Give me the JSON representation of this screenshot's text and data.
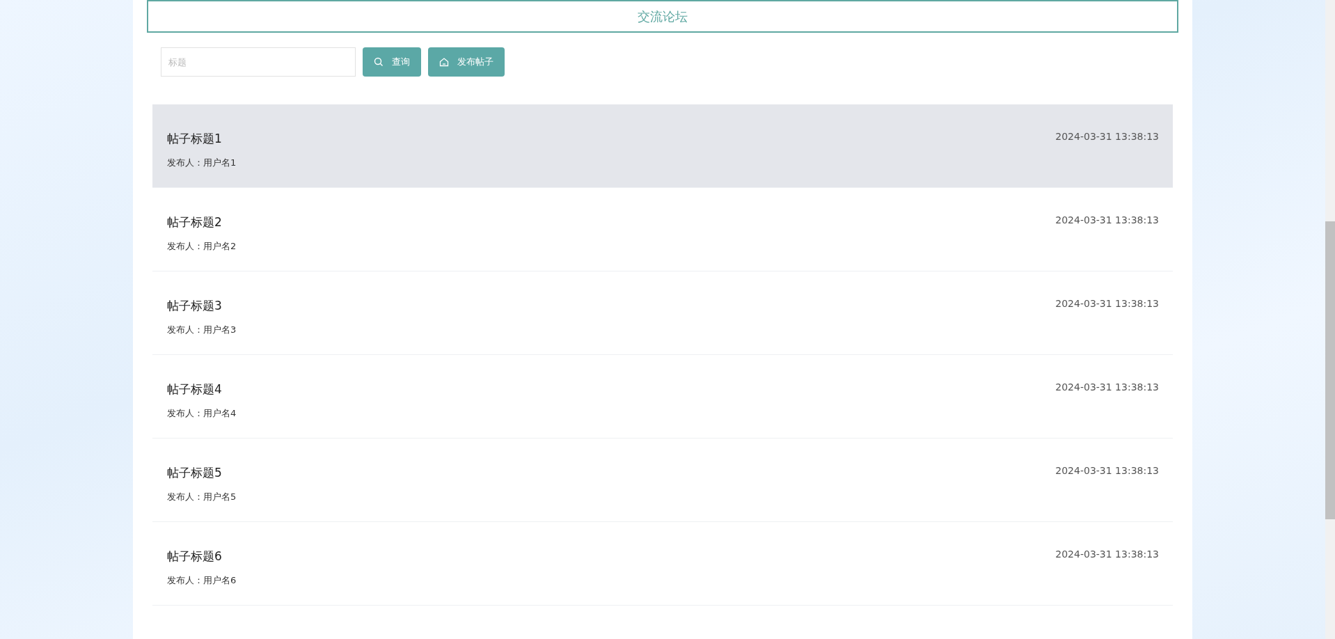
{
  "header": {
    "title": "交流论坛"
  },
  "search": {
    "placeholder": "标题"
  },
  "buttons": [
    {
      "kind": "search",
      "label": "查询"
    },
    {
      "kind": "home",
      "label": "发布帖子"
    }
  ],
  "posts": [
    {
      "title": "帖子标题1",
      "author": "发布人：用户名1",
      "time": "2024-03-31 13:38:13",
      "highlighted": true
    },
    {
      "title": "帖子标题2",
      "author": "发布人：用户名2",
      "time": "2024-03-31 13:38:13",
      "highlighted": false
    },
    {
      "title": "帖子标题3",
      "author": "发布人：用户名3",
      "time": "2024-03-31 13:38:13",
      "highlighted": false
    },
    {
      "title": "帖子标题4",
      "author": "发布人：用户名4",
      "time": "2024-03-31 13:38:13",
      "highlighted": false
    },
    {
      "title": "帖子标题5",
      "author": "发布人：用户名5",
      "time": "2024-03-31 13:38:13",
      "highlighted": false
    },
    {
      "title": "帖子标题6",
      "author": "发布人：用户名6",
      "time": "2024-03-31 13:38:13",
      "highlighted": false
    }
  ]
}
